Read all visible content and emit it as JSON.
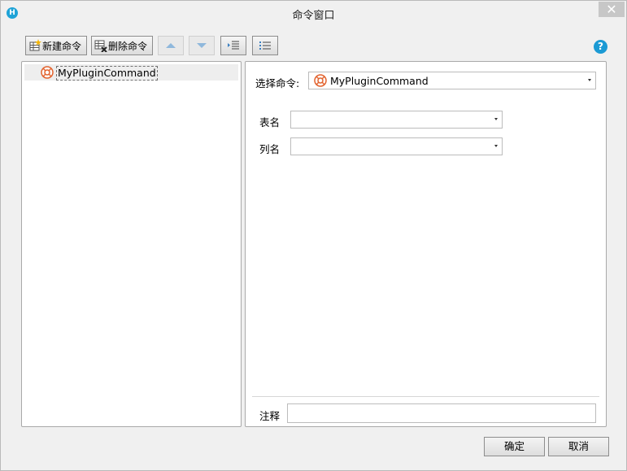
{
  "window": {
    "title": "命令窗口",
    "close_glyph": "✕"
  },
  "toolbar": {
    "new_label": "新建命令",
    "delete_label": "删除命令"
  },
  "tree": {
    "items": [
      {
        "label": "MyPluginCommand"
      }
    ]
  },
  "form": {
    "select_command_label": "选择命令:",
    "select_command_value": "MyPluginCommand",
    "table_label": "表名",
    "table_value": "",
    "column_label": "列名",
    "column_value": "",
    "comment_label": "注释",
    "comment_value": ""
  },
  "buttons": {
    "ok": "确定",
    "cancel": "取消"
  },
  "colors": {
    "accent": "#1b9ad4",
    "plugin_icon": "#e2622d"
  }
}
